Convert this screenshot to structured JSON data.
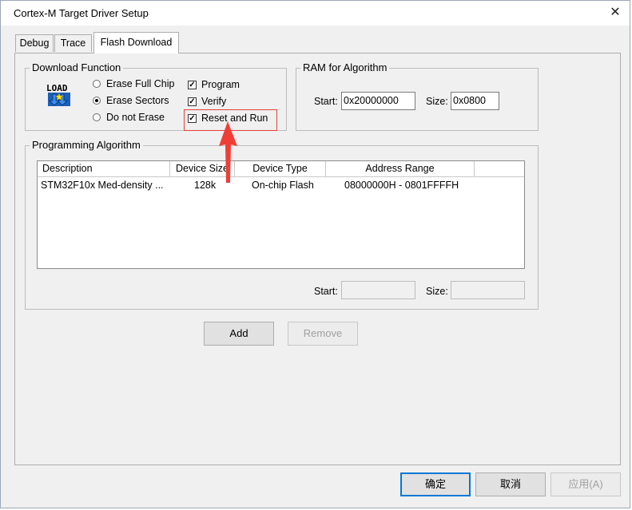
{
  "window": {
    "title": "Cortex-M Target Driver Setup",
    "close_glyph": "✕"
  },
  "tabs": [
    {
      "label": "Debug",
      "active": false
    },
    {
      "label": "Trace",
      "active": false
    },
    {
      "label": "Flash Download",
      "active": true
    }
  ],
  "download_function": {
    "legend": "Download Function",
    "icon": {
      "name": "load-icon",
      "text": "LOAD"
    },
    "radios": [
      {
        "label": "Erase Full Chip",
        "checked": false
      },
      {
        "label": "Erase Sectors",
        "checked": true
      },
      {
        "label": "Do not Erase",
        "checked": false
      }
    ],
    "checkboxes": [
      {
        "label": "Program",
        "checked": true
      },
      {
        "label": "Verify",
        "checked": true
      },
      {
        "label": "Reset and Run",
        "checked": true
      }
    ]
  },
  "ram": {
    "legend": "RAM for Algorithm",
    "start_label": "Start:",
    "start_value": "0x20000000",
    "size_label": "Size:",
    "size_value": "0x0800"
  },
  "programming_algorithm": {
    "legend": "Programming Algorithm",
    "columns": [
      "Description",
      "Device Size",
      "Device Type",
      "Address Range"
    ],
    "rows": [
      [
        "STM32F10x Med-density ...",
        "128k",
        "On-chip Flash",
        "08000000H - 0801FFFFH"
      ]
    ],
    "start_label": "Start:",
    "start_value": "",
    "size_label": "Size:",
    "size_value": ""
  },
  "buttons": {
    "add": "Add",
    "remove": "Remove",
    "ok": "确定",
    "cancel": "取消",
    "apply": "应用(A)"
  },
  "annotation": {
    "highlight_color": "#e5403a"
  }
}
